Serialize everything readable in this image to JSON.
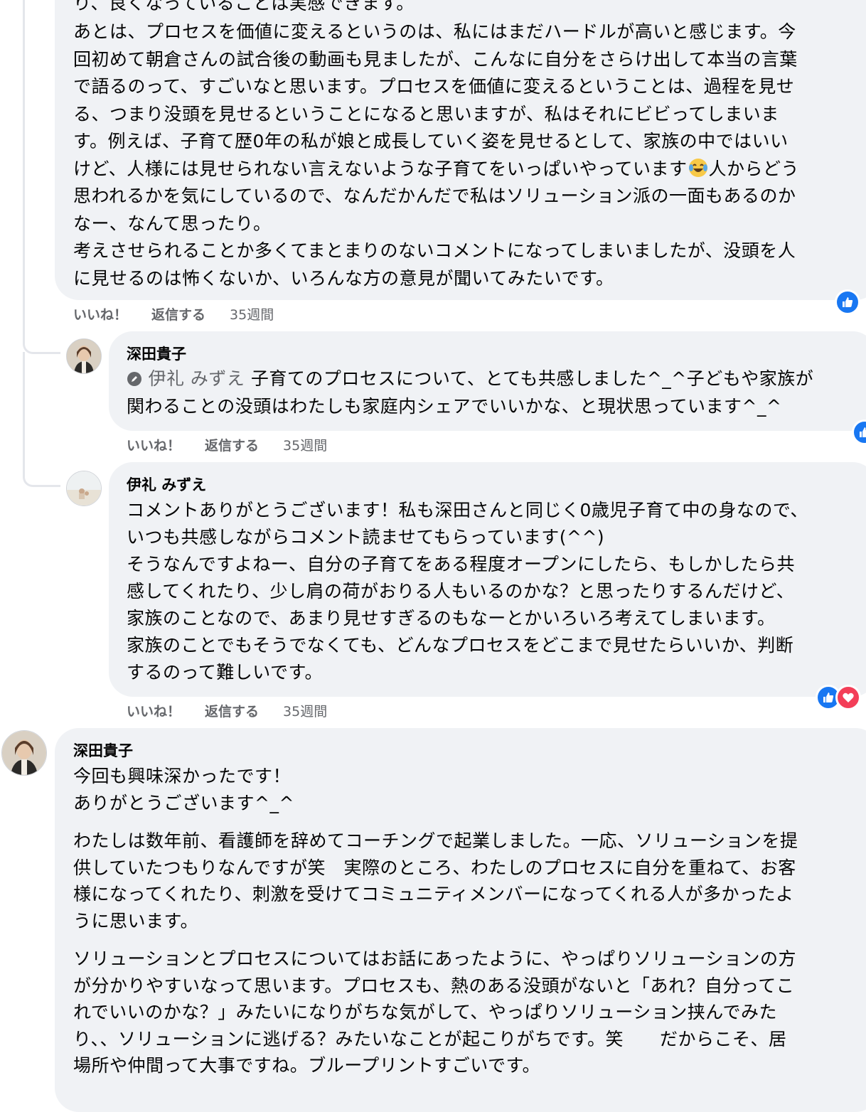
{
  "comments": [
    {
      "paragraphs": [
        "り、良くなっていることは実感できます。",
        "あとは、プロセスを価値に変えるというのは、私にはまだハードルが高いと感じます。今回初めて朝倉さんの試合後の動画も見ましたが、こんなに自分をさらけ出して本当の言葉で語るのって、すごいなと思います。プロセスを価値に変えるということは、過程を見せる、つまり没頭を見せるということになると思いますが、私はそれにビビってしまいます。例えば、子育て歴0年の私が娘と成長していく姿を見せるとして、家族の中ではいいけど、人様には見せられない言えないような子育てをいっぱいやっています",
        "人からどう思われるかを気にしているので、なんだかんだで私はソリューション派の一面もあるのかなー、なんて思ったり。",
        "考えさせられることか多くてまとまりのないコメントになってしまいましたが、没頭を人に見せるのは怖くないか、いろんな方の意見が聞いてみたいです。"
      ],
      "lines": [
        "あとは、プロセスを価値に変えるというのは、私にはまだハードルが高いと感じます。今",
        "回初めて朝倉さんの試合後の動画も見ましたが、こんなに自分をさらけ出して本当の言葉",
        "で語るのって、すごいなと思います。プロセスを価値に変えるということは、過程を見せ",
        "る、つまり没頭を見せるということになると思いますが、私はそれにビビってしまいま",
        "す。例えば、子育て歴0年の私が娘と成長していく姿を見せるとして、家族の中ではいい",
        "けど、人様には見せられない言えないような子育てをいっぱいやっています",
        "人からどう",
        "思われるかを気にしているので、なんだかんだで私はソリューション派の一面もあるのか",
        "なー、なんて思ったり。",
        "考えさせられることか多くてまとまりのないコメントになってしまいましたが、没頭を人",
        "に見せるのは怖くないか、いろんな方の意見が聞いてみたいです。"
      ],
      "top_line": "り、良くなっていることは実感できます。",
      "emoji": "laughing-tears-emoji",
      "actions": {
        "like": "いいね！",
        "reply": "返信する",
        "time": "35週間"
      }
    },
    {
      "author": "深田貴子",
      "mention": "伊礼 みずえ",
      "lines": [
        "子育てのプロセスについて、とても共感しました^_^子どもや家族が",
        "関わることの没頭はわたしも家庭内シェアでいいかな、と現状思っています^_^"
      ],
      "actions": {
        "like": "いいね！",
        "reply": "返信する",
        "time": "35週間"
      }
    },
    {
      "author": "伊礼 みずえ",
      "lines": [
        "コメントありがとうございます！私も深田さんと同じく0歳児子育て中の身なので、",
        "いつも共感しながらコメント読ませてもらっています(^^)",
        "そうなんですよねー、自分の子育てをある程度オープンにしたら、もしかしたら共",
        "感してくれたり、少し肩の荷がおりる人もいるのかな？と思ったりするんだけど、",
        "家族のことなので、あまり見せすぎるのもなーとかいろいろ考えてしまいます。",
        "家族のことでもそうでなくても、どんなプロセスをどこまで見せたらいいか、判断",
        "するのって難しいです。"
      ],
      "actions": {
        "like": "いいね！",
        "reply": "返信する",
        "time": "35週間"
      }
    },
    {
      "author": "深田貴子",
      "lines_a": [
        "今回も興味深かったです！",
        "ありがとうございます^_^"
      ],
      "lines_b": [
        "わたしは数年前、看護師を辞めてコーチングで起業しました。一応、ソリューションを提",
        "供していたつもりなんですが笑　実際のところ、わたしのプロセスに自分を重ねて、お客",
        "様になってくれたり、刺激を受けてコミュニティメンバーになってくれる人が多かったよ",
        "うに思います。"
      ],
      "lines_c": [
        "ソリューションとプロセスについてはお話にあったように、やっぱりソリューションの方",
        "が分かりやすいなって思います。プロセスも、熱のある没頭がないと「あれ？自分ってこ",
        "れでいいのかな？」みたいになりがちな気がして、やっぱりソリューション挟んでみた",
        "り、、ソリューションに逃げる？みたいなことが起こりがちです。笑　　だからこそ、居",
        "場所や仲間って大事ですね。ブループリントすごいです。"
      ]
    }
  ],
  "colors": {
    "bubble": "#f0f2f5",
    "meta": "#65676b",
    "like": "#1877f2",
    "love": "#f33e58"
  }
}
